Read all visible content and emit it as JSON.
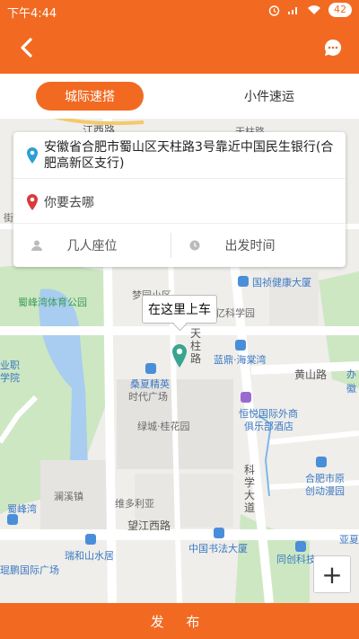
{
  "status_bar": {
    "time": "下午4:44",
    "battery": "42"
  },
  "header": {
    "back_icon": "back-arrow-icon",
    "chat_icon": "chat-bubble-icon"
  },
  "tabs": [
    {
      "label": "城际速搭",
      "active": true
    },
    {
      "label": "小件速运",
      "active": false
    }
  ],
  "trip_form": {
    "from_address": "安徽省合肥市蜀山区天柱路3号靠近中国民生银行(合肥高新区支行)",
    "to_placeholder": "你要去哪",
    "seats_label": "几人座位",
    "time_label": "出发时间"
  },
  "map": {
    "pickup_bubble": "在这里上车",
    "labels": {
      "road_jiangxi_top": "江西路",
      "tianzhu_top": "天柱路",
      "shufeng": "蜀峰湾体育公园",
      "mengyuan": "梦园小区",
      "guozhen": "国祯健康大厦",
      "yike": "亿科学园",
      "tianzhu_vertical": "天柱路",
      "landing": "蓝鼎·海棠湾",
      "huangshan": "黄山路",
      "sangyuan": "桑夏精英",
      "shidai": "时代广场",
      "lvcheng": "绿城·桂花园",
      "hengyue": "恒悦国际外商",
      "julebu": "俱乐部酒店",
      "kexue": "科学大道",
      "hefei_yuanchuang": "合肥市原",
      "chuangdong": "创动漫园",
      "lanxizhen": "澜溪镇",
      "weiduo": "维多利亚",
      "wangjiang": "望江西路",
      "shufengwan": "蜀峰湾",
      "ruihe": "瑞和山水居",
      "kunpeng": "琨鹏国际广场",
      "zhongguo_shufa": "中国书法大厦",
      "tongchuang": "同创科技",
      "yaxia": "亚夏",
      "yezhi": "业职",
      "xueyuan": "学院",
      "jie": "街",
      "hui": "徽",
      "ban": "办"
    },
    "zoom_in": "+"
  },
  "publish_button": "发  布",
  "colors": {
    "brand": "#f26a22",
    "pin_blue": "#2a9fd6",
    "pin_red": "#d93a3a",
    "marker_teal": "#3aa58f"
  }
}
